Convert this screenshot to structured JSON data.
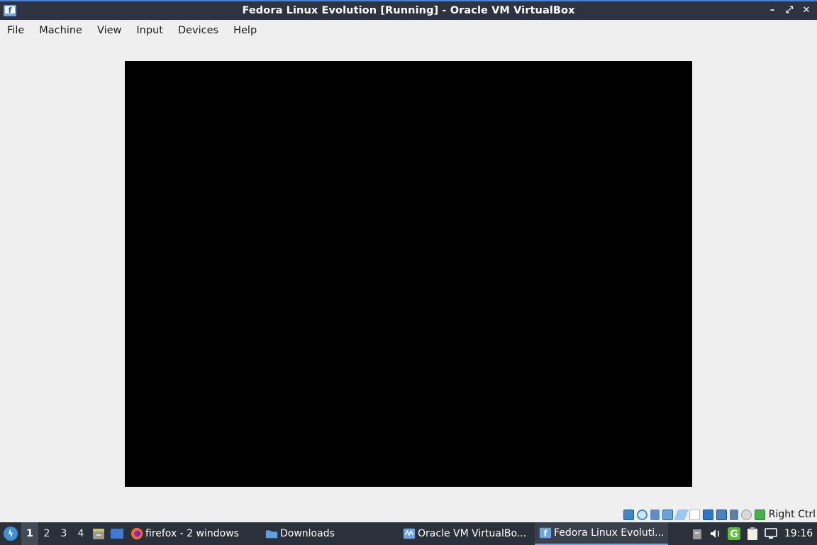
{
  "window": {
    "title": "Fedora Linux Evolution [Running] - Oracle VM VirtualBox",
    "icon": "virtualbox-fedora-icon",
    "controls": {
      "minimize": "–",
      "maximize": "⤢",
      "close": "✕"
    }
  },
  "menubar": {
    "items": [
      "File",
      "Machine",
      "View",
      "Input",
      "Devices",
      "Help"
    ]
  },
  "vm": {
    "display_color": "#000000"
  },
  "status_bar": {
    "icons": [
      "hard-disk-icon",
      "optical-drive-icon",
      "audio-icon",
      "network-icon",
      "usb-icon",
      "shared-folders-icon",
      "display-icon",
      "recording-icon",
      "cpu-icon",
      "mouse-integration-icon",
      "keyboard-capture-icon"
    ],
    "host_key": "Right Ctrl"
  },
  "taskbar": {
    "desktops": [
      "1",
      "2",
      "3",
      "4"
    ],
    "active_desktop": "1",
    "tasks": [
      {
        "label": "firefox - 2 windows",
        "icon": "firefox-icon"
      },
      {
        "label": "Downloads",
        "icon": "folder-icon"
      },
      {
        "label": "Oracle VM VirtualBo...",
        "icon": "virtualbox-icon"
      },
      {
        "label": "Fedora Linux Evoluti...",
        "icon": "virtualbox-fedora-icon"
      }
    ],
    "tray": [
      "trash-icon",
      "volume-icon",
      "g-icon",
      "clipboard-icon",
      "network-wired-icon"
    ],
    "clock": "19:16"
  },
  "colors": {
    "titlebar": "#2d3340",
    "taskbar": "#2b313b",
    "accent": "#4a7fd1"
  }
}
